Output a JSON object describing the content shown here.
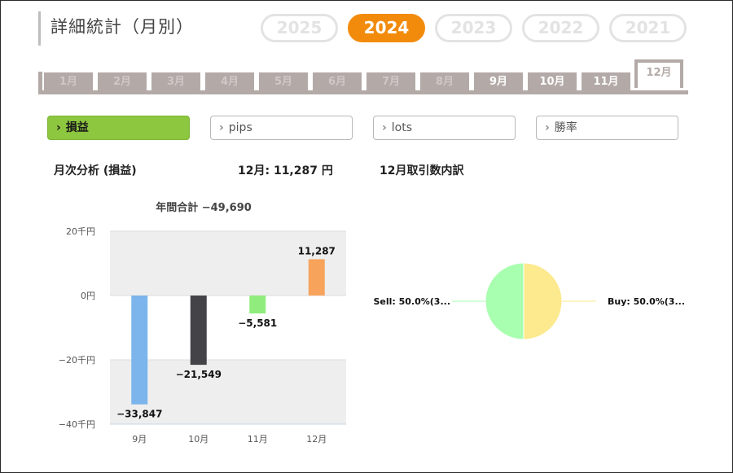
{
  "header": {
    "title": "詳細統計（月別）"
  },
  "years": [
    {
      "label": "2025",
      "active": false
    },
    {
      "label": "2024",
      "active": true
    },
    {
      "label": "2023",
      "active": false
    },
    {
      "label": "2022",
      "active": false
    },
    {
      "label": "2021",
      "active": false
    }
  ],
  "months": [
    {
      "label": "1月",
      "bright": false
    },
    {
      "label": "2月",
      "bright": false
    },
    {
      "label": "3月",
      "bright": false
    },
    {
      "label": "4月",
      "bright": false
    },
    {
      "label": "5月",
      "bright": false
    },
    {
      "label": "6月",
      "bright": false
    },
    {
      "label": "7月",
      "bright": false
    },
    {
      "label": "8月",
      "bright": false
    },
    {
      "label": "9月",
      "bright": true
    },
    {
      "label": "10月",
      "bright": true
    },
    {
      "label": "11月",
      "bright": true
    }
  ],
  "active_month": "12月",
  "metrics": [
    {
      "label": "損益",
      "active": true
    },
    {
      "label": "pips",
      "active": false
    },
    {
      "label": "lots",
      "active": false
    },
    {
      "label": "勝率",
      "active": false
    }
  ],
  "summary": {
    "analysis_label": "月次分析 (損益)",
    "month_value": "12月:  11,287 円",
    "breakdown_label": "12月取引数内訳"
  },
  "chart_data": [
    {
      "type": "bar",
      "title": "年間合計 −49,690",
      "categories": [
        "9月",
        "10月",
        "11月",
        "12月"
      ],
      "values": [
        -33847,
        -21549,
        -5581,
        11287
      ],
      "value_labels": [
        "−33,847",
        "−21,549",
        "−5,581",
        "11,287"
      ],
      "colors": [
        "#7cb5ec",
        "#434348",
        "#90ed7d",
        "#f7a35c"
      ],
      "ylim": [
        -40000,
        20000
      ],
      "yticks": [
        20000,
        0,
        -20000,
        -40000
      ],
      "ytick_labels": [
        "20千円",
        "0円",
        "−20千円",
        "−40千円"
      ],
      "grid": true,
      "legend": false
    },
    {
      "type": "pie",
      "labels": [
        "Sell: 50.0%(3...",
        "Buy: 50.0%(3..."
      ],
      "values": [
        50.0,
        50.0
      ],
      "colors": [
        "#a9ffb0",
        "#fde98e"
      ]
    }
  ]
}
